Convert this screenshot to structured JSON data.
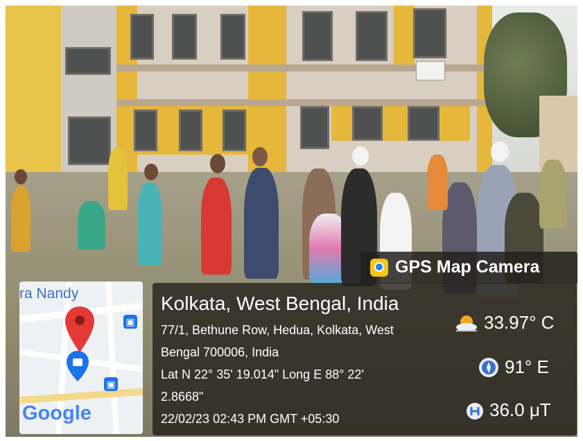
{
  "map": {
    "street_label": "ra Nandy",
    "logo": "Google"
  },
  "watermark": {
    "icon": "camera-pin-icon",
    "title": "GPS Map Camera"
  },
  "location": {
    "city_line": "Kolkata, West Bengal, India",
    "address_line1": "77/1, Bethune Row, Hedua, Kolkata, West",
    "address_line2": "Bengal 700006, India",
    "coords_line1": "Lat N 22° 35' 19.014\" Long E 88° 22'",
    "coords_line2": "2.8668\"",
    "datetime": "22/02/23 02:43 PM GMT +05:30"
  },
  "readings": {
    "temperature": "33.97° C",
    "heading": "91° E",
    "magnetic": "36.0 μT"
  },
  "colors": {
    "overlay": "#23211c",
    "pin": "#e53935",
    "map_marker": "#1a73e8"
  }
}
